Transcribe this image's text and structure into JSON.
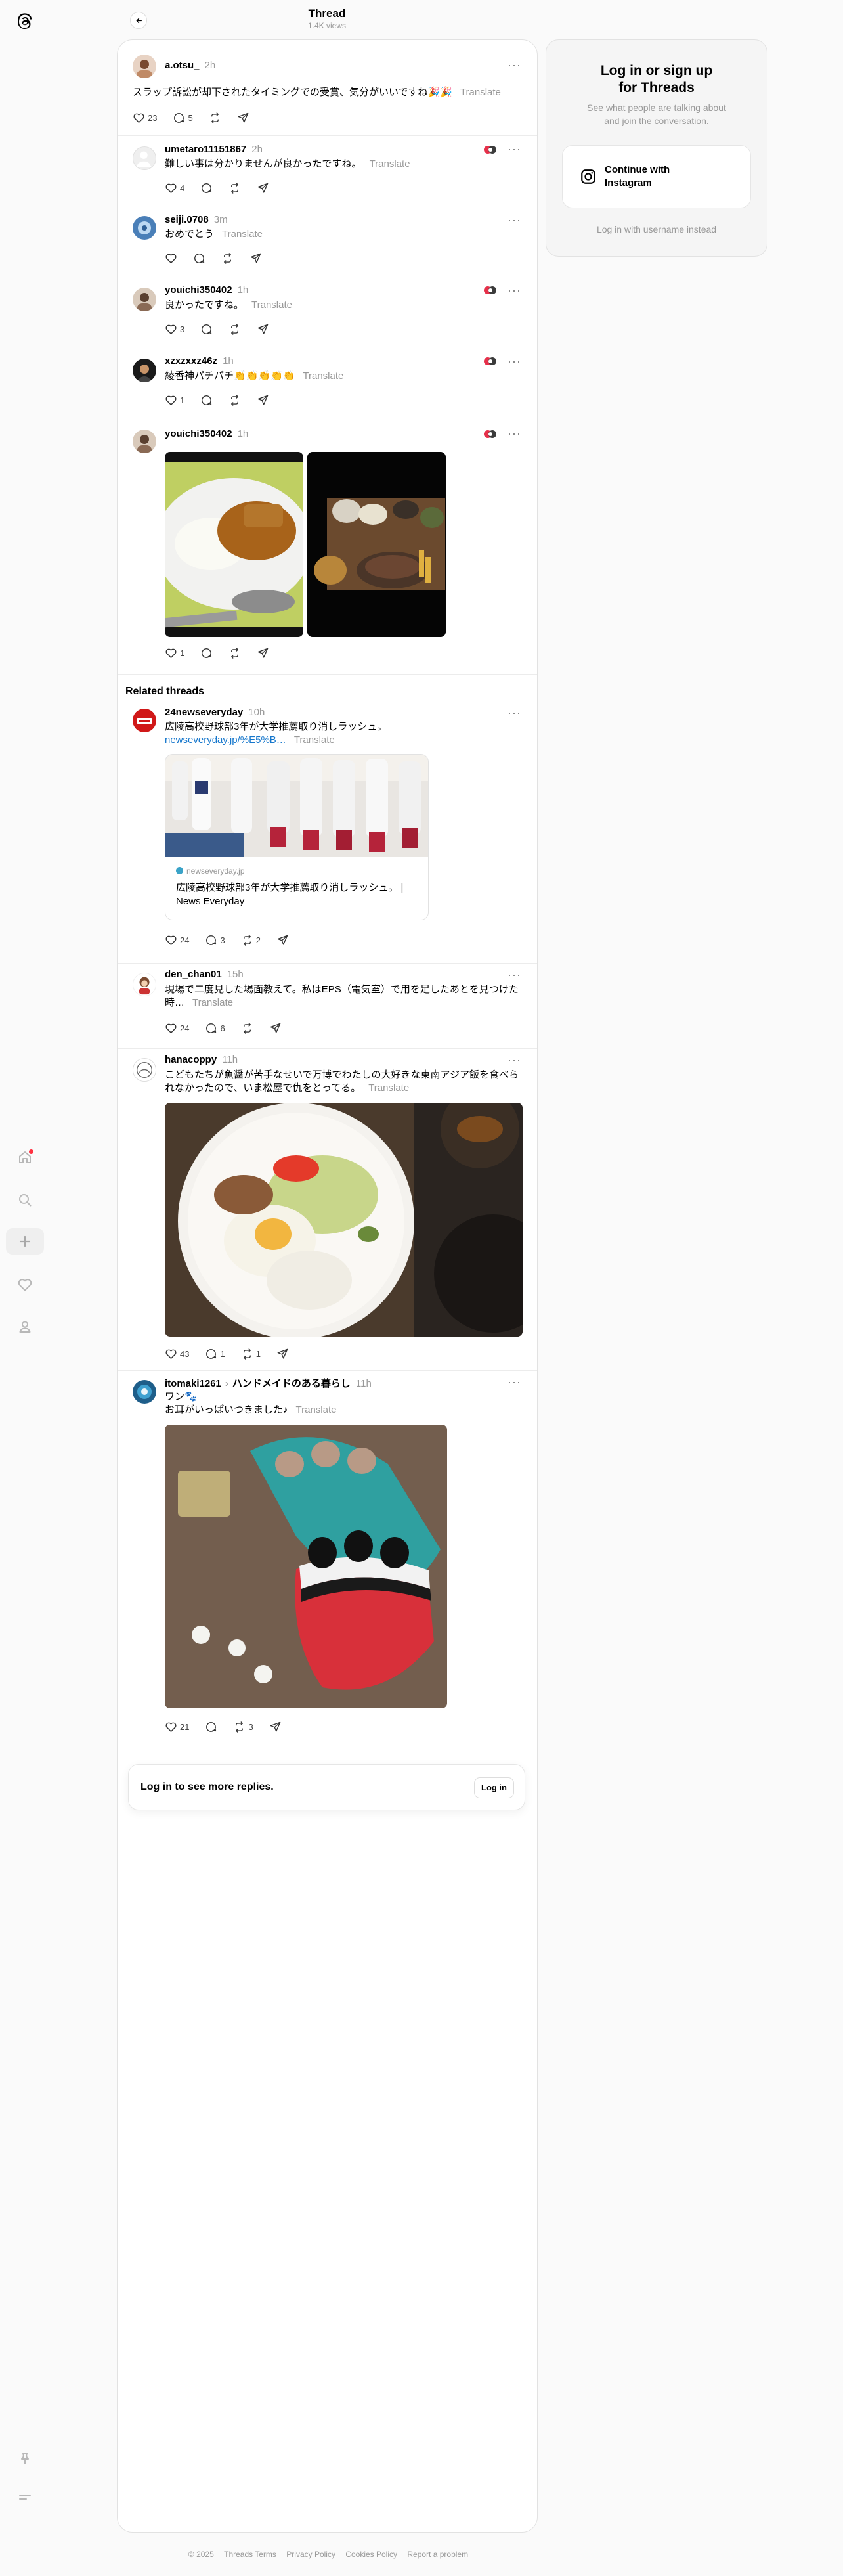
{
  "header": {
    "title": "Thread",
    "views": "1.4K views"
  },
  "posts": [
    {
      "user": "a.otsu_",
      "time": "2h",
      "text": "スラップ訴訟が却下されたタイミングでの受賞、気分がいいですね🎉🎉",
      "translate": "Translate",
      "likes": "23",
      "replies": "5"
    },
    {
      "user": "umetaro11151867",
      "time": "2h",
      "text": "難しい事は分かりませんが良かったですね。",
      "translate": "Translate",
      "likes": "4"
    },
    {
      "user": "seiji.0708",
      "time": "3m",
      "text": "おめでとう",
      "translate": "Translate"
    },
    {
      "user": "youichi350402",
      "time": "1h",
      "text": "良かったですね。",
      "translate": "Translate",
      "likes": "3"
    },
    {
      "user": "xzxzxxz46z",
      "time": "1h",
      "text": "綾香神パチパチ👏👏👏👏👏",
      "translate": "Translate",
      "likes": "1"
    },
    {
      "user": "youichi350402",
      "time": "1h",
      "likes": "1"
    }
  ],
  "related_title": "Related threads",
  "related": [
    {
      "user": "24newseveryday",
      "time": "10h",
      "text": "広陵高校野球部3年が大学推薦取り消しラッシュ。",
      "link": "newseveryday.jp/%E5%B…",
      "translate": "Translate",
      "card_domain": "newseveryday.jp",
      "card_title_1": "広陵高校野球部3年が大学推薦取り消しラッシュ。 |",
      "card_title_2": "News Everyday",
      "likes": "24",
      "replies": "3",
      "reposts": "2"
    },
    {
      "user": "den_chan01",
      "time": "15h",
      "text_1": "現場で二度見した場面教えて。私はEPS（電気室）で用を足したあとを見つけた",
      "text_2": "時…",
      "translate": "Translate",
      "likes": "24",
      "replies": "6"
    },
    {
      "user": "hanacoppy",
      "time": "11h",
      "text_1": "こどもたちが魚醤が苦手なせいで万博でわたしの大好きな東南アジア飯を食べら",
      "text_2": "れなかったので、いま松屋で仇をとってる。",
      "translate": "Translate",
      "likes": "43",
      "replies": "1",
      "reposts": "1"
    },
    {
      "user": "itomaki1261",
      "topic": "ハンドメイドのある暮らし",
      "time": "11h",
      "text_1": "ワン🐾",
      "text_2": "お耳がいっぱいつきました♪",
      "translate": "Translate",
      "likes": "21",
      "reposts": "3"
    }
  ],
  "login_bar": {
    "text": "Log in to see more replies.",
    "button": "Log in"
  },
  "login_card": {
    "title_1": "Log in or sign up",
    "title_2": "for Threads",
    "subtitle_1": "See what people are talking about",
    "subtitle_2": "and join the conversation.",
    "instagram_1": "Continue with",
    "instagram_2": "Instagram",
    "username_link": "Log in with username instead"
  },
  "footer": [
    "© 2025",
    "Threads Terms",
    "Privacy Policy",
    "Cookies Policy",
    "Report a problem"
  ],
  "colors": {
    "link": "#1677cc",
    "muted": "#999999",
    "notification_dot": "#ff3040"
  }
}
